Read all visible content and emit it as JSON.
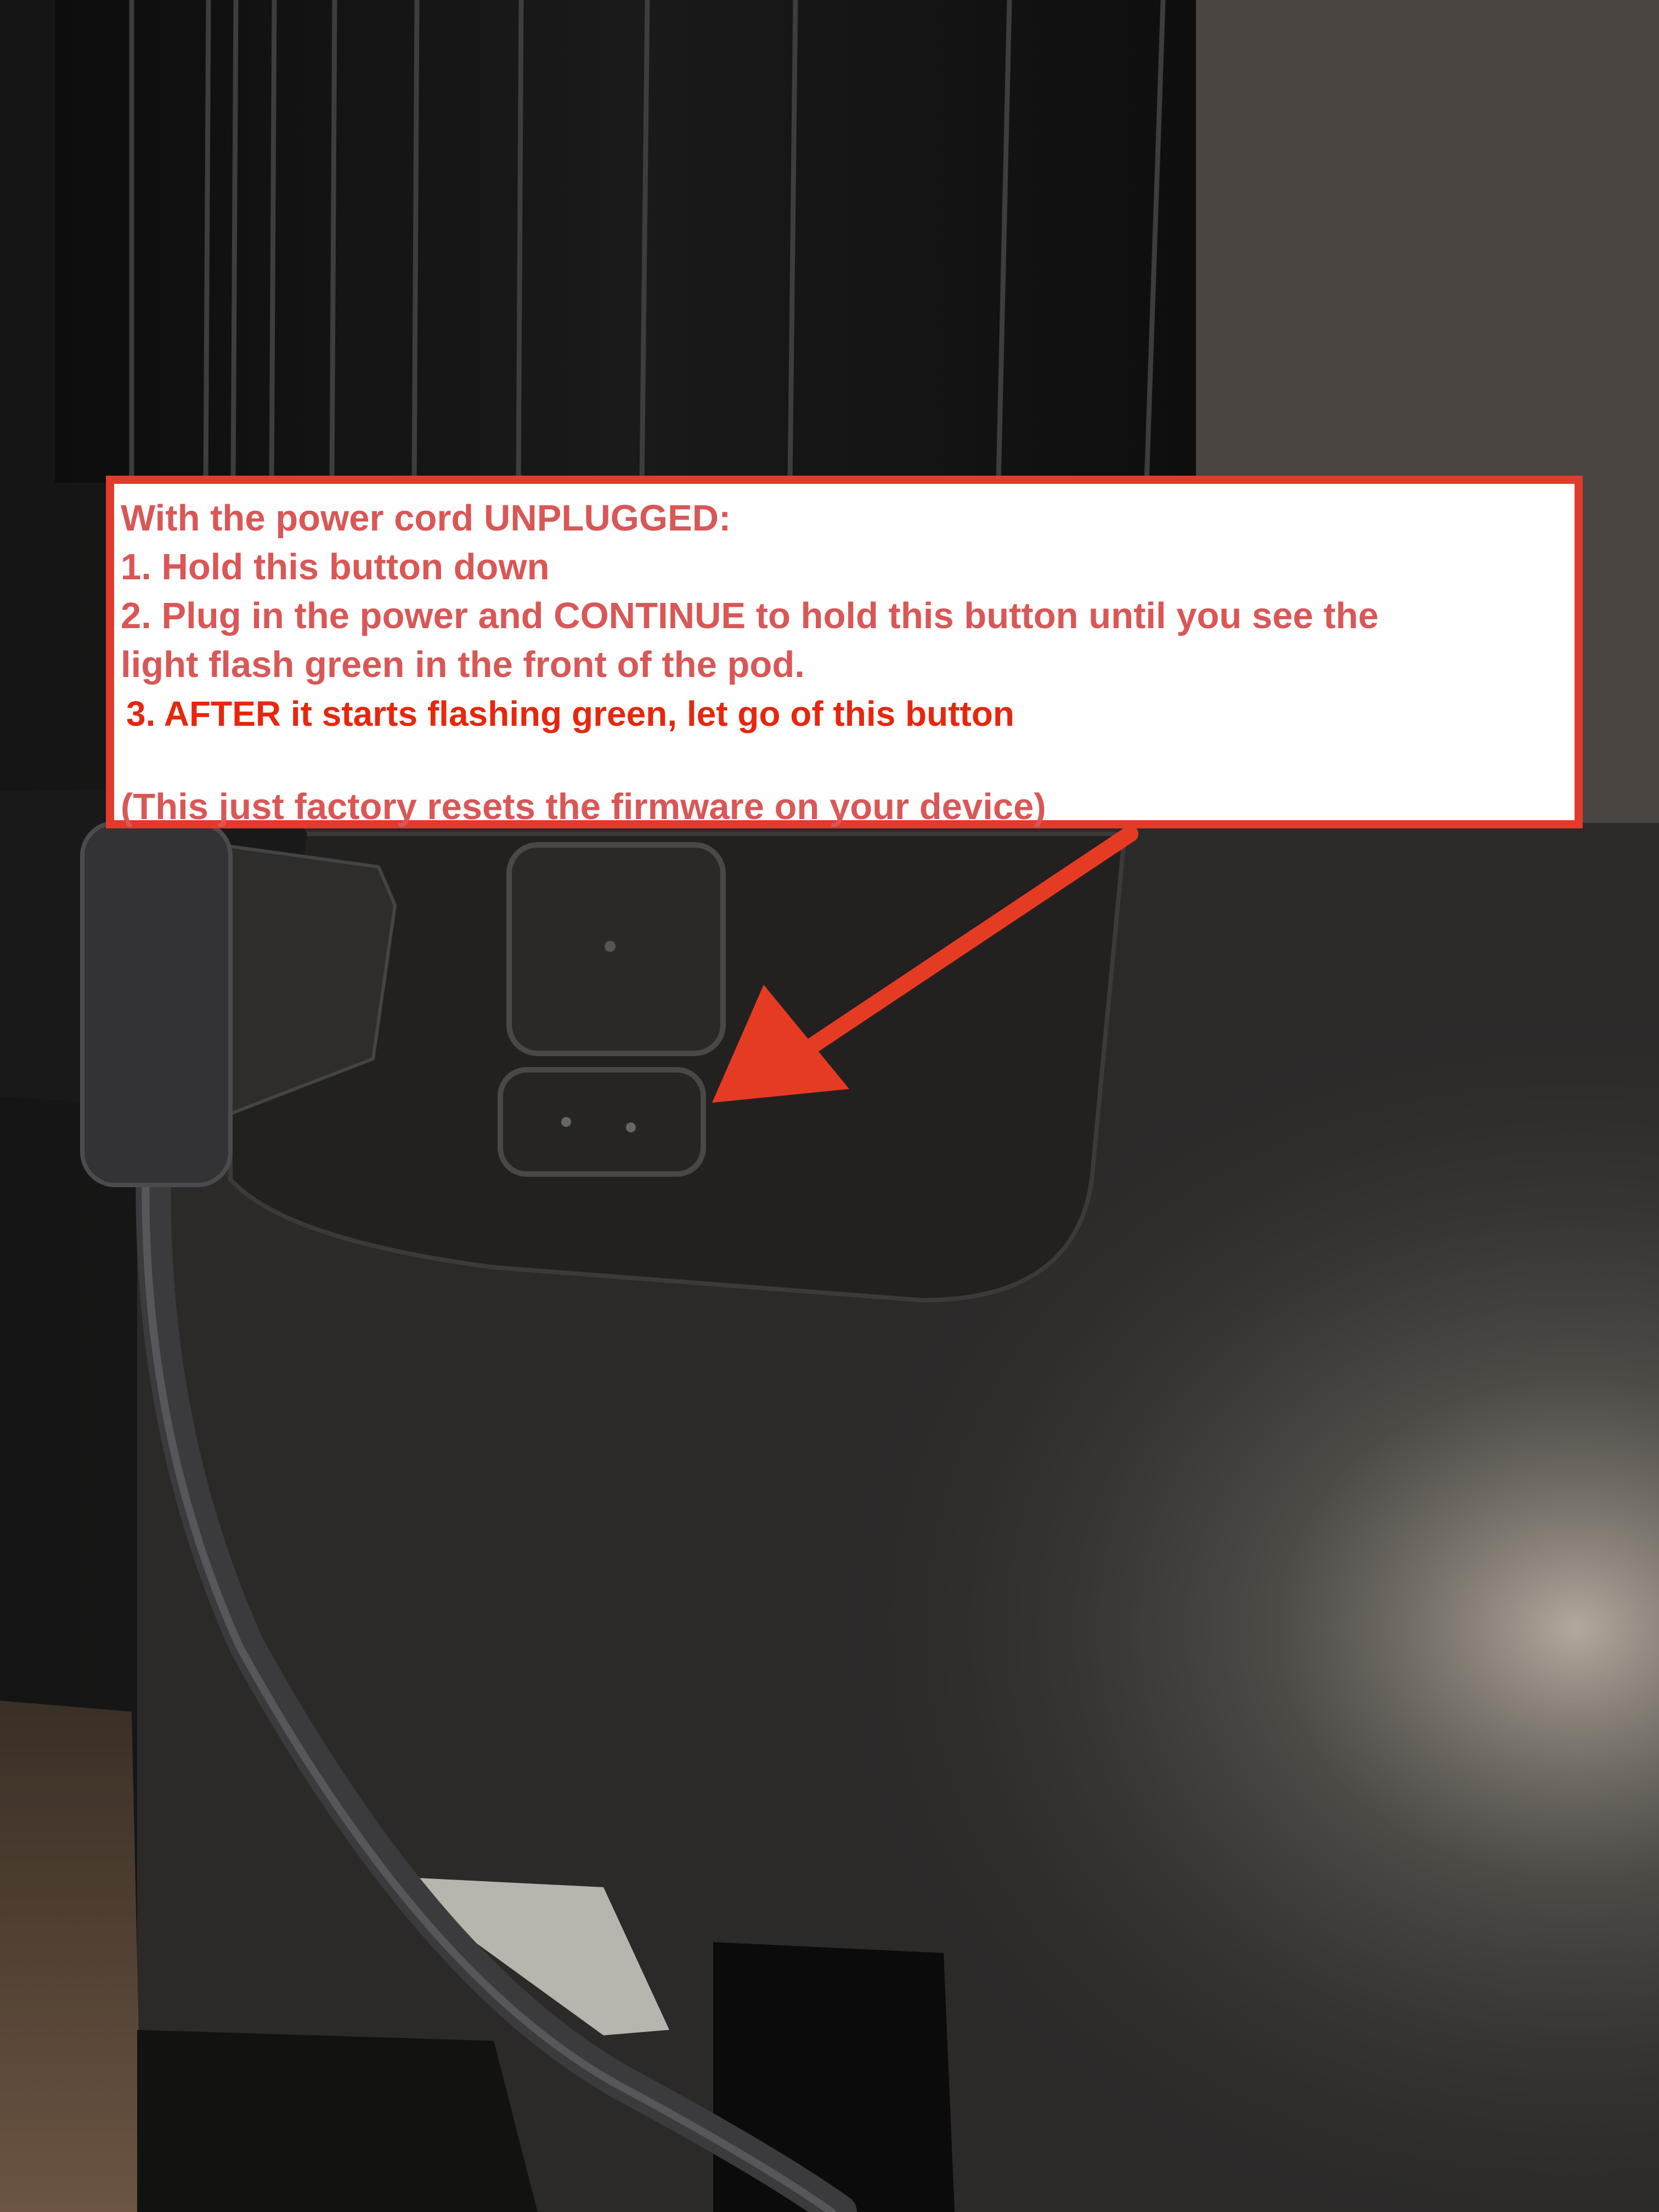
{
  "annotation": {
    "intro": "With the power cord UNPLUGGED:",
    "step1": "1. Hold this button down",
    "step2_line1": "2. Plug in the power and CONTINUE to hold this button until you see the",
    "step2_line2": "light flash green in the front of the pod.",
    "step3": "3. AFTER it starts flashing green, let go of this button",
    "note": "(This just factory resets the firmware on your device)"
  },
  "colors": {
    "annotation_border": "#e23a2b",
    "annotation_text": "#d95757",
    "step3_text": "#e6270e",
    "arrow": "#e63b23",
    "device_body": "#2b2a29"
  },
  "icons": {
    "arrow": "arrow-pointing-to-reset-button"
  }
}
